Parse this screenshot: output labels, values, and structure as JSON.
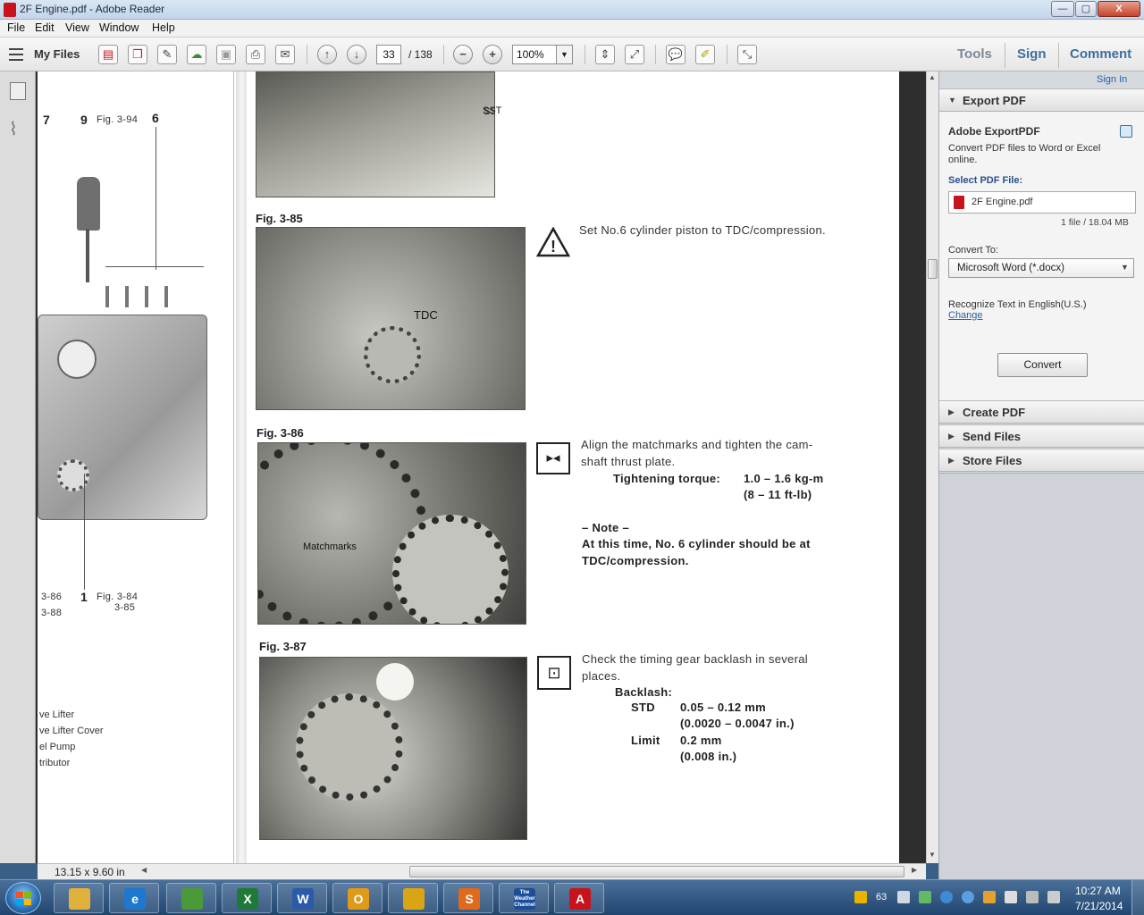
{
  "window": {
    "title": "2F Engine.pdf - Adobe Reader",
    "min_label": "—",
    "max_label": "▢",
    "close_label": "X"
  },
  "menu": [
    "File",
    "Edit",
    "View",
    "Window",
    "Help"
  ],
  "toolbar": {
    "my_files": "My Files",
    "page_current": "33",
    "page_total": "/ 138",
    "zoom": "100%",
    "tools": "Tools",
    "sign": "Sign",
    "comment": "Comment"
  },
  "document": {
    "left_page": {
      "callouts": {
        "n7": "7",
        "n9": "9",
        "fig94": "Fig. 3-94",
        "n6": "6",
        "fig86": "3-86",
        "fig88": "3-88",
        "n1": "1",
        "fig84": "Fig. 3-84",
        "fig85": "3-85"
      },
      "legend": [
        "ve Lifter",
        "ve Lifter Cover",
        "el Pump",
        "tributor"
      ]
    },
    "photo_labels": {
      "sst": "SST",
      "tdc": "TDC",
      "matchmarks": "Matchmarks"
    },
    "figures": [
      {
        "label": "Fig. 3-85",
        "lines": [
          "Set No.6 cylinder piston to TDC/compression."
        ]
      },
      {
        "label": "Fig. 3-86",
        "lines": [
          "Align the matchmarks and tighten the cam-",
          "shaft thrust plate."
        ],
        "torque_label": "Tightening torque:",
        "torque_value": "1.0 – 1.6 kg-m",
        "torque_value2": "(8 – 11 ft-lb)",
        "note_title": "– Note –",
        "note_lines": [
          "At this time, No. 6 cylinder should be at",
          "TDC/compression."
        ]
      },
      {
        "label": "Fig. 3-87",
        "lines": [
          "Check the timing gear backlash in several",
          "places."
        ],
        "backlash": "Backlash:",
        "std_label": "STD",
        "std_value": "0.05 – 0.12 mm",
        "std_value2": "(0.0020 – 0.0047 in.)",
        "limit_label": "Limit",
        "limit_value": "0.2 mm",
        "limit_value2": "(0.008 in.)"
      }
    ]
  },
  "status": {
    "page_size": "13.15 x 9.60 in"
  },
  "panel": {
    "sign_in": "Sign In",
    "export": {
      "title": "Export PDF",
      "service": "Adobe ExportPDF",
      "description": "Convert PDF files to Word or Excel online.",
      "select_label": "Select PDF File:",
      "file_name": "2F Engine.pdf",
      "file_info": "1 file / 18.04 MB",
      "convert_to_label": "Convert To:",
      "format": "Microsoft Word (*.docx)",
      "recognize": "Recognize Text in English(U.S.)",
      "change": "Change",
      "convert_button": "Convert"
    },
    "sections": [
      "Create PDF",
      "Send Files",
      "Store Files"
    ]
  },
  "taskbar": {
    "tray_badge": "63",
    "time": "10:27 AM",
    "date": "7/21/2014",
    "weather_label": "The Weather Channel",
    "apps": [
      {
        "name": "explorer-app",
        "glyph": "",
        "color": "#e0b13c"
      },
      {
        "name": "ie-app",
        "glyph": "e",
        "color": "#1e78d2"
      },
      {
        "name": "maps-app",
        "glyph": "",
        "color": "#4a9a3a"
      },
      {
        "name": "excel-app",
        "glyph": "X",
        "color": "#1f7a3a"
      },
      {
        "name": "word-app",
        "glyph": "W",
        "color": "#2b5aa8"
      },
      {
        "name": "outlook-app",
        "glyph": "O",
        "color": "#e09a1a"
      },
      {
        "name": "chrome-app",
        "glyph": "",
        "color": "#d9a515"
      },
      {
        "name": "snagit-app",
        "glyph": "S",
        "color": "#e06a1a"
      },
      {
        "name": "weather-app",
        "glyph": "",
        "color": "#1b4d9b"
      },
      {
        "name": "acrobat-app",
        "glyph": "A",
        "color": "#c8131c"
      }
    ]
  }
}
